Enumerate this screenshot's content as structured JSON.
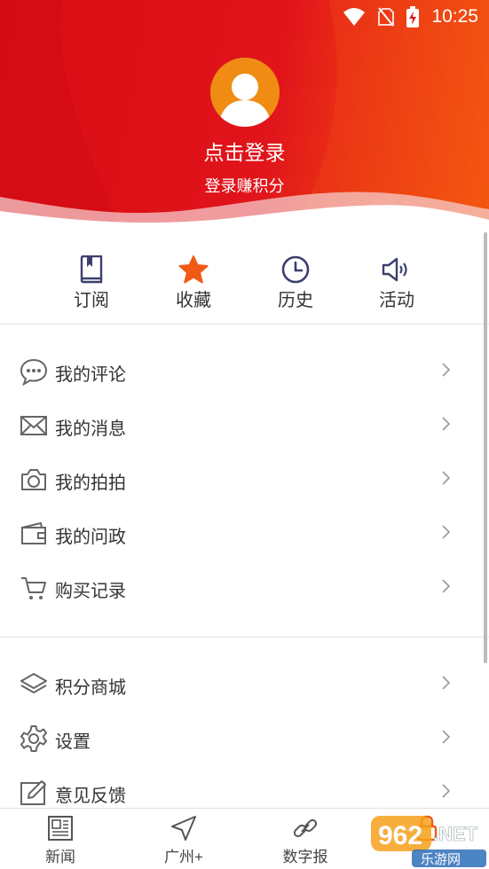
{
  "status_bar": {
    "time": "10:25"
  },
  "profile": {
    "login_label": "点击登录",
    "subtitle": "登录赚积分"
  },
  "quick_actions": [
    {
      "label": "订阅",
      "icon": "book-icon"
    },
    {
      "label": "收藏",
      "icon": "star-icon"
    },
    {
      "label": "历史",
      "icon": "clock-icon"
    },
    {
      "label": "活动",
      "icon": "speaker-icon"
    }
  ],
  "menu_group1": [
    {
      "label": "我的评论",
      "icon": "comment-icon"
    },
    {
      "label": "我的消息",
      "icon": "mail-icon"
    },
    {
      "label": "我的拍拍",
      "icon": "camera-icon"
    },
    {
      "label": "我的问政",
      "icon": "wallet-icon"
    },
    {
      "label": "购买记录",
      "icon": "cart-icon"
    }
  ],
  "menu_group2": [
    {
      "label": "积分商城",
      "icon": "layers-icon"
    },
    {
      "label": "设置",
      "icon": "gear-icon"
    },
    {
      "label": "意见反馈",
      "icon": "edit-icon"
    }
  ],
  "tab_bar": [
    {
      "label": "新闻",
      "icon": "newspaper-icon"
    },
    {
      "label": "广州+",
      "icon": "navigation-icon"
    },
    {
      "label": "数字报",
      "icon": "link-icon"
    },
    {
      "label": "",
      "icon": "lock-icon"
    }
  ],
  "watermark": "962.NET 乐游网",
  "colors": {
    "header_red": "#e1141b",
    "header_orange": "#f6620c",
    "avatar_orange": "#f08c14",
    "accent_star": "#f05a16",
    "icon_navy": "#3c3f6e"
  }
}
